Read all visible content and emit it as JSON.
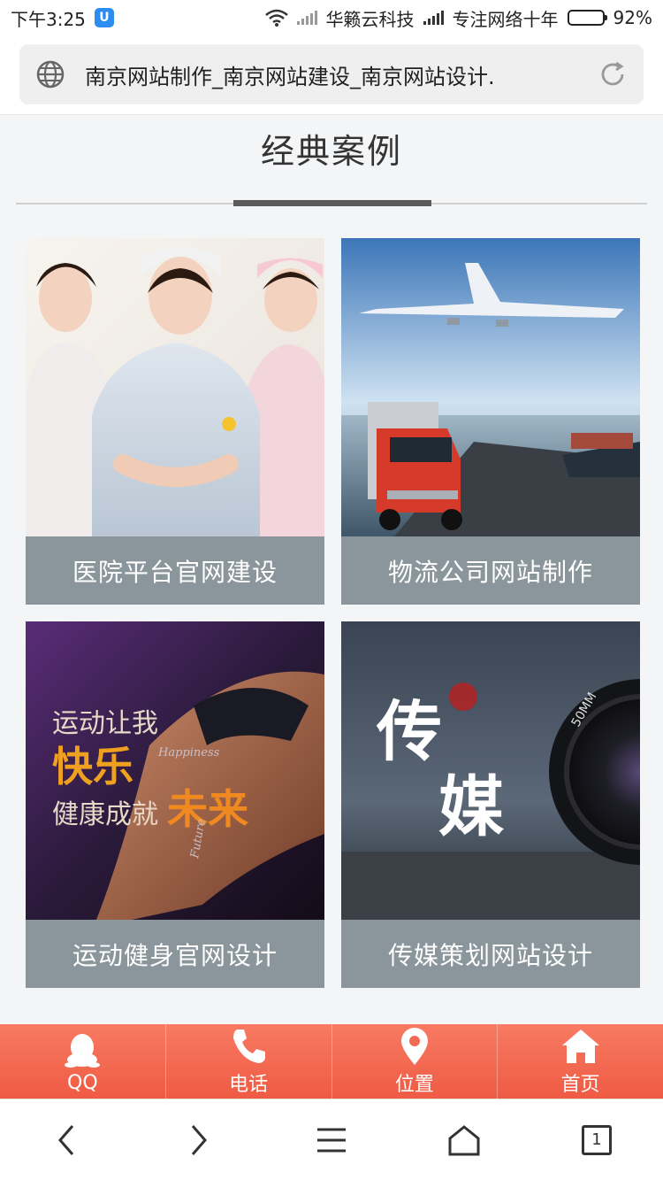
{
  "status_bar": {
    "time": "下午3:25",
    "carrier1": "华籁云科技",
    "carrier2": "专注网络十年",
    "battery": "92%",
    "battery_level": 0.92
  },
  "address_bar": {
    "url_text": "南京网站制作_南京网站建设_南京网站设计."
  },
  "section": {
    "title": "经典案例"
  },
  "cases": [
    {
      "caption": "医院平台官网建设"
    },
    {
      "caption": "物流公司网站制作"
    },
    {
      "caption": "运动健身官网设计",
      "image_text": {
        "line1": "运动让我",
        "line2": "快乐",
        "line3": "健康成就",
        "line4": "未来",
        "sub1": "Happiness",
        "sub2": "Future"
      }
    },
    {
      "caption": "传媒策划网站设计",
      "image_text": {
        "big1": "传",
        "big2": "媒",
        "lens": "50MM"
      }
    }
  ],
  "bottom_nav": [
    {
      "label": "QQ",
      "icon": "qq-icon"
    },
    {
      "label": "电话",
      "icon": "phone-icon"
    },
    {
      "label": "位置",
      "icon": "location-icon"
    },
    {
      "label": "首页",
      "icon": "home-icon"
    }
  ],
  "browser_toolbar": {
    "tab_count": "1"
  },
  "colors": {
    "nav_gradient_top": "#f87a62",
    "nav_gradient_bottom": "#ef5b44",
    "caption_bg": "#8a969c"
  }
}
